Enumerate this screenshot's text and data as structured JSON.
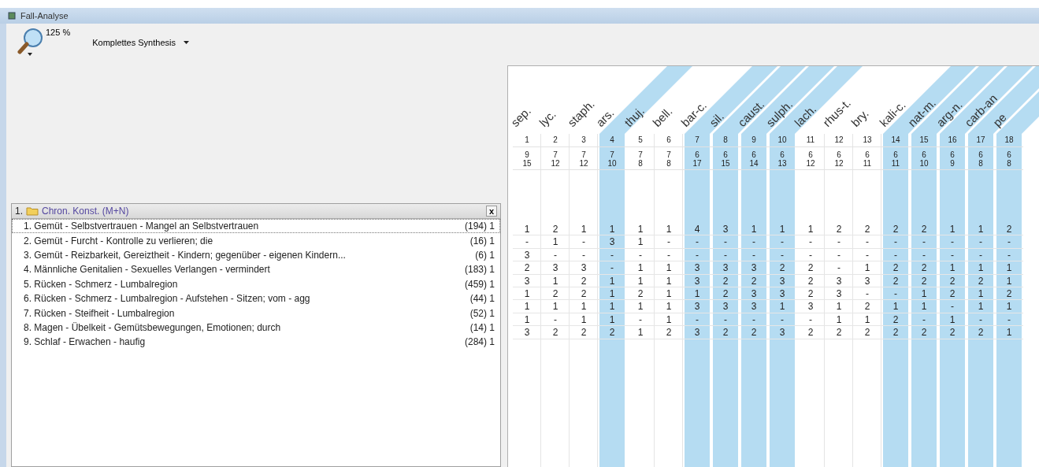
{
  "window": {
    "title": "Fall-Analyse"
  },
  "toolbar": {
    "zoom": "125 %",
    "view": "Komplettes Synthesis"
  },
  "group": {
    "number": "1.",
    "title": "Chron. Konst. (M+N)",
    "close": "x"
  },
  "rubrics": [
    {
      "text": "1. Gemüt - Selbstvertrauen - Mangel an Selbstvertrauen",
      "count": "(194) 1",
      "selected": true
    },
    {
      "text": "2. Gemüt - Furcht - Kontrolle zu verlieren; die",
      "count": "(16) 1",
      "selected": false
    },
    {
      "text": "3. Gemüt - Reizbarkeit, Gereiztheit - Kindern; gegenüber - eigenen Kindern...",
      "count": "(6) 1",
      "selected": false
    },
    {
      "text": "4. Männliche Genitalien - Sexuelles Verlangen - vermindert",
      "count": "(183) 1",
      "selected": false
    },
    {
      "text": "5. Rücken - Schmerz - Lumbalregion",
      "count": "(459) 1",
      "selected": false
    },
    {
      "text": "6. Rücken - Schmerz - Lumbalregion - Aufstehen - Sitzen; vom - agg",
      "count": "(44) 1",
      "selected": false
    },
    {
      "text": "7. Rücken - Steifheit - Lumbalregion",
      "count": "(52) 1",
      "selected": false
    },
    {
      "text": "8. Magen - Übelkeit - Gemütsbewegungen, Emotionen; durch",
      "count": "(14) 1",
      "selected": false
    },
    {
      "text": "9. Schlaf - Erwachen - haufig",
      "count": "(284) 1",
      "selected": false
    }
  ],
  "columns": [
    {
      "name": "sep.",
      "index": "1",
      "hits": "9",
      "sum": "15",
      "highlighted": false,
      "values": [
        "1",
        "-",
        "3",
        "2",
        "3",
        "1",
        "1",
        "1",
        "3"
      ]
    },
    {
      "name": "lyc.",
      "index": "2",
      "hits": "7",
      "sum": "12",
      "highlighted": false,
      "values": [
        "2",
        "1",
        "-",
        "3",
        "1",
        "2",
        "1",
        "-",
        "2"
      ]
    },
    {
      "name": "staph.",
      "index": "3",
      "hits": "7",
      "sum": "12",
      "highlighted": false,
      "values": [
        "1",
        "-",
        "-",
        "3",
        "2",
        "2",
        "1",
        "1",
        "2"
      ]
    },
    {
      "name": "ars.",
      "index": "4",
      "hits": "7",
      "sum": "10",
      "highlighted": true,
      "values": [
        "1",
        "3",
        "-",
        "-",
        "1",
        "1",
        "1",
        "1",
        "2"
      ]
    },
    {
      "name": "thuj.",
      "index": "5",
      "hits": "7",
      "sum": "8",
      "highlighted": false,
      "values": [
        "1",
        "1",
        "-",
        "1",
        "1",
        "2",
        "1",
        "-",
        "1"
      ]
    },
    {
      "name": "bell.",
      "index": "6",
      "hits": "7",
      "sum": "8",
      "highlighted": false,
      "values": [
        "1",
        "-",
        "-",
        "1",
        "1",
        "1",
        "1",
        "1",
        "2"
      ]
    },
    {
      "name": "bar-c.",
      "index": "7",
      "hits": "6",
      "sum": "17",
      "highlighted": true,
      "values": [
        "4",
        "-",
        "-",
        "3",
        "3",
        "1",
        "3",
        "-",
        "3"
      ]
    },
    {
      "name": "sil.",
      "index": "8",
      "hits": "6",
      "sum": "15",
      "highlighted": true,
      "values": [
        "3",
        "-",
        "-",
        "3",
        "2",
        "2",
        "3",
        "-",
        "2"
      ]
    },
    {
      "name": "caust.",
      "index": "9",
      "hits": "6",
      "sum": "14",
      "highlighted": true,
      "values": [
        "1",
        "-",
        "-",
        "3",
        "2",
        "3",
        "3",
        "-",
        "2"
      ]
    },
    {
      "name": "sulph.",
      "index": "10",
      "hits": "6",
      "sum": "13",
      "highlighted": true,
      "values": [
        "1",
        "-",
        "-",
        "2",
        "3",
        "3",
        "1",
        "-",
        "3"
      ]
    },
    {
      "name": "lach.",
      "index": "11",
      "hits": "6",
      "sum": "12",
      "highlighted": false,
      "values": [
        "1",
        "-",
        "-",
        "2",
        "2",
        "2",
        "3",
        "-",
        "2"
      ]
    },
    {
      "name": "rhus-t.",
      "index": "12",
      "hits": "6",
      "sum": "12",
      "highlighted": false,
      "values": [
        "2",
        "-",
        "-",
        "-",
        "3",
        "3",
        "1",
        "1",
        "2"
      ]
    },
    {
      "name": "bry.",
      "index": "13",
      "hits": "6",
      "sum": "11",
      "highlighted": false,
      "values": [
        "2",
        "-",
        "-",
        "1",
        "3",
        "-",
        "2",
        "1",
        "2"
      ]
    },
    {
      "name": "kali-c.",
      "index": "14",
      "hits": "6",
      "sum": "11",
      "highlighted": true,
      "values": [
        "2",
        "-",
        "-",
        "2",
        "2",
        "-",
        "1",
        "2",
        "2"
      ]
    },
    {
      "name": "nat-m.",
      "index": "15",
      "hits": "6",
      "sum": "10",
      "highlighted": true,
      "values": [
        "2",
        "-",
        "-",
        "2",
        "2",
        "1",
        "1",
        "-",
        "2"
      ]
    },
    {
      "name": "arg-n.",
      "index": "16",
      "hits": "6",
      "sum": "9",
      "highlighted": true,
      "values": [
        "1",
        "-",
        "-",
        "1",
        "2",
        "2",
        "-",
        "1",
        "2"
      ]
    },
    {
      "name": "carb-an",
      "index": "17",
      "hits": "6",
      "sum": "8",
      "highlighted": true,
      "values": [
        "1",
        "-",
        "-",
        "1",
        "2",
        "1",
        "1",
        "-",
        "2"
      ]
    },
    {
      "name": "pe",
      "index": "18",
      "hits": "6",
      "sum": "8",
      "highlighted": true,
      "values": [
        "2",
        "-",
        "-",
        "1",
        "1",
        "2",
        "1",
        "-",
        "1"
      ]
    }
  ]
}
